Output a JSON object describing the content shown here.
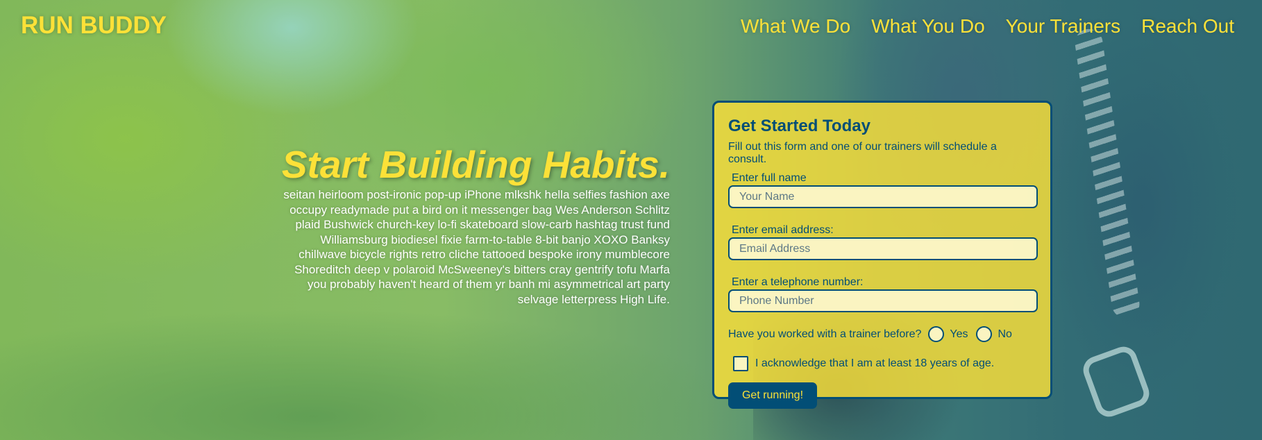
{
  "header": {
    "logo": "RUN BUDDY",
    "nav": [
      "What We Do",
      "What You Do",
      "Your Trainers",
      "Reach Out"
    ]
  },
  "hero": {
    "title": "Start Building Habits.",
    "body_lines": [
      "seitan heirloom post-ironic pop-up iPhone mlkshk hella selfies fashion axe",
      "occupy readymade put a bird on it messenger bag Wes Anderson Schlitz",
      "plaid Bushwick church-key lo-fi skateboard slow-carb hashtag trust fund",
      "Williamsburg biodiesel fixie farm-to-table 8-bit banjo XOXO Banksy",
      "chillwave bicycle rights retro cliche tattooed bespoke irony mumblecore",
      "Shoreditch deep v polaroid McSweeney's bitters cray gentrify tofu Marfa",
      "you probably haven't heard of them yr banh mi asymmetrical art party",
      "selvage letterpress High Life."
    ]
  },
  "form": {
    "title": "Get Started Today",
    "subtitle": "Fill out this form and one of our trainers will schedule a consult.",
    "name_label": "Enter full name",
    "name_placeholder": "Your Name",
    "email_label": "Enter email address:",
    "email_placeholder": "Email Address",
    "phone_label": "Enter a telephone number:",
    "phone_placeholder": "Phone Number",
    "trainer_question": "Have you worked with a trainer before?",
    "yes_label": "Yes",
    "no_label": "No",
    "acknowledge_label": "I acknowledge that I am at least 18 years of age.",
    "submit_label": "Get running!"
  },
  "colors": {
    "accent": "#fce138",
    "primary": "#024e76"
  }
}
